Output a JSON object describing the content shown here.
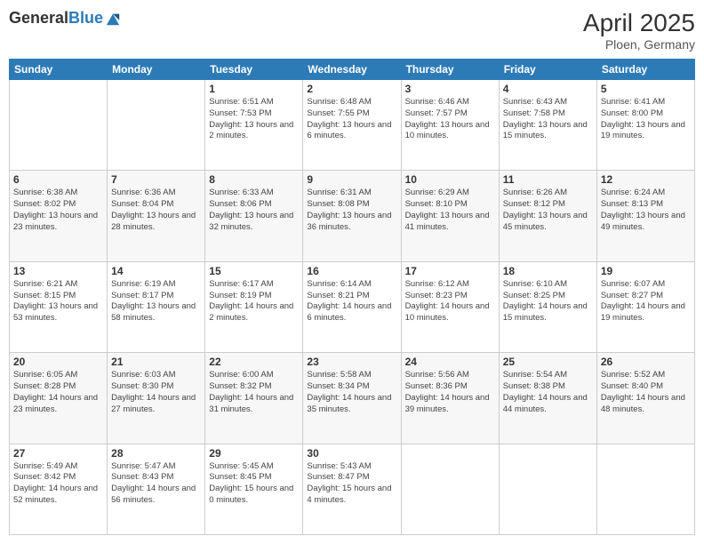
{
  "header": {
    "logo_general": "General",
    "logo_blue": "Blue",
    "main_title": "April 2025",
    "subtitle": "Ploen, Germany"
  },
  "days_of_week": [
    "Sunday",
    "Monday",
    "Tuesday",
    "Wednesday",
    "Thursday",
    "Friday",
    "Saturday"
  ],
  "weeks": [
    [
      {
        "num": "",
        "info": ""
      },
      {
        "num": "",
        "info": ""
      },
      {
        "num": "1",
        "info": "Sunrise: 6:51 AM\nSunset: 7:53 PM\nDaylight: 13 hours and 2 minutes."
      },
      {
        "num": "2",
        "info": "Sunrise: 6:48 AM\nSunset: 7:55 PM\nDaylight: 13 hours and 6 minutes."
      },
      {
        "num": "3",
        "info": "Sunrise: 6:46 AM\nSunset: 7:57 PM\nDaylight: 13 hours and 10 minutes."
      },
      {
        "num": "4",
        "info": "Sunrise: 6:43 AM\nSunset: 7:58 PM\nDaylight: 13 hours and 15 minutes."
      },
      {
        "num": "5",
        "info": "Sunrise: 6:41 AM\nSunset: 8:00 PM\nDaylight: 13 hours and 19 minutes."
      }
    ],
    [
      {
        "num": "6",
        "info": "Sunrise: 6:38 AM\nSunset: 8:02 PM\nDaylight: 13 hours and 23 minutes."
      },
      {
        "num": "7",
        "info": "Sunrise: 6:36 AM\nSunset: 8:04 PM\nDaylight: 13 hours and 28 minutes."
      },
      {
        "num": "8",
        "info": "Sunrise: 6:33 AM\nSunset: 8:06 PM\nDaylight: 13 hours and 32 minutes."
      },
      {
        "num": "9",
        "info": "Sunrise: 6:31 AM\nSunset: 8:08 PM\nDaylight: 13 hours and 36 minutes."
      },
      {
        "num": "10",
        "info": "Sunrise: 6:29 AM\nSunset: 8:10 PM\nDaylight: 13 hours and 41 minutes."
      },
      {
        "num": "11",
        "info": "Sunrise: 6:26 AM\nSunset: 8:12 PM\nDaylight: 13 hours and 45 minutes."
      },
      {
        "num": "12",
        "info": "Sunrise: 6:24 AM\nSunset: 8:13 PM\nDaylight: 13 hours and 49 minutes."
      }
    ],
    [
      {
        "num": "13",
        "info": "Sunrise: 6:21 AM\nSunset: 8:15 PM\nDaylight: 13 hours and 53 minutes."
      },
      {
        "num": "14",
        "info": "Sunrise: 6:19 AM\nSunset: 8:17 PM\nDaylight: 13 hours and 58 minutes."
      },
      {
        "num": "15",
        "info": "Sunrise: 6:17 AM\nSunset: 8:19 PM\nDaylight: 14 hours and 2 minutes."
      },
      {
        "num": "16",
        "info": "Sunrise: 6:14 AM\nSunset: 8:21 PM\nDaylight: 14 hours and 6 minutes."
      },
      {
        "num": "17",
        "info": "Sunrise: 6:12 AM\nSunset: 8:23 PM\nDaylight: 14 hours and 10 minutes."
      },
      {
        "num": "18",
        "info": "Sunrise: 6:10 AM\nSunset: 8:25 PM\nDaylight: 14 hours and 15 minutes."
      },
      {
        "num": "19",
        "info": "Sunrise: 6:07 AM\nSunset: 8:27 PM\nDaylight: 14 hours and 19 minutes."
      }
    ],
    [
      {
        "num": "20",
        "info": "Sunrise: 6:05 AM\nSunset: 8:28 PM\nDaylight: 14 hours and 23 minutes."
      },
      {
        "num": "21",
        "info": "Sunrise: 6:03 AM\nSunset: 8:30 PM\nDaylight: 14 hours and 27 minutes."
      },
      {
        "num": "22",
        "info": "Sunrise: 6:00 AM\nSunset: 8:32 PM\nDaylight: 14 hours and 31 minutes."
      },
      {
        "num": "23",
        "info": "Sunrise: 5:58 AM\nSunset: 8:34 PM\nDaylight: 14 hours and 35 minutes."
      },
      {
        "num": "24",
        "info": "Sunrise: 5:56 AM\nSunset: 8:36 PM\nDaylight: 14 hours and 39 minutes."
      },
      {
        "num": "25",
        "info": "Sunrise: 5:54 AM\nSunset: 8:38 PM\nDaylight: 14 hours and 44 minutes."
      },
      {
        "num": "26",
        "info": "Sunrise: 5:52 AM\nSunset: 8:40 PM\nDaylight: 14 hours and 48 minutes."
      }
    ],
    [
      {
        "num": "27",
        "info": "Sunrise: 5:49 AM\nSunset: 8:42 PM\nDaylight: 14 hours and 52 minutes."
      },
      {
        "num": "28",
        "info": "Sunrise: 5:47 AM\nSunset: 8:43 PM\nDaylight: 14 hours and 56 minutes."
      },
      {
        "num": "29",
        "info": "Sunrise: 5:45 AM\nSunset: 8:45 PM\nDaylight: 15 hours and 0 minutes."
      },
      {
        "num": "30",
        "info": "Sunrise: 5:43 AM\nSunset: 8:47 PM\nDaylight: 15 hours and 4 minutes."
      },
      {
        "num": "",
        "info": ""
      },
      {
        "num": "",
        "info": ""
      },
      {
        "num": "",
        "info": ""
      }
    ]
  ]
}
